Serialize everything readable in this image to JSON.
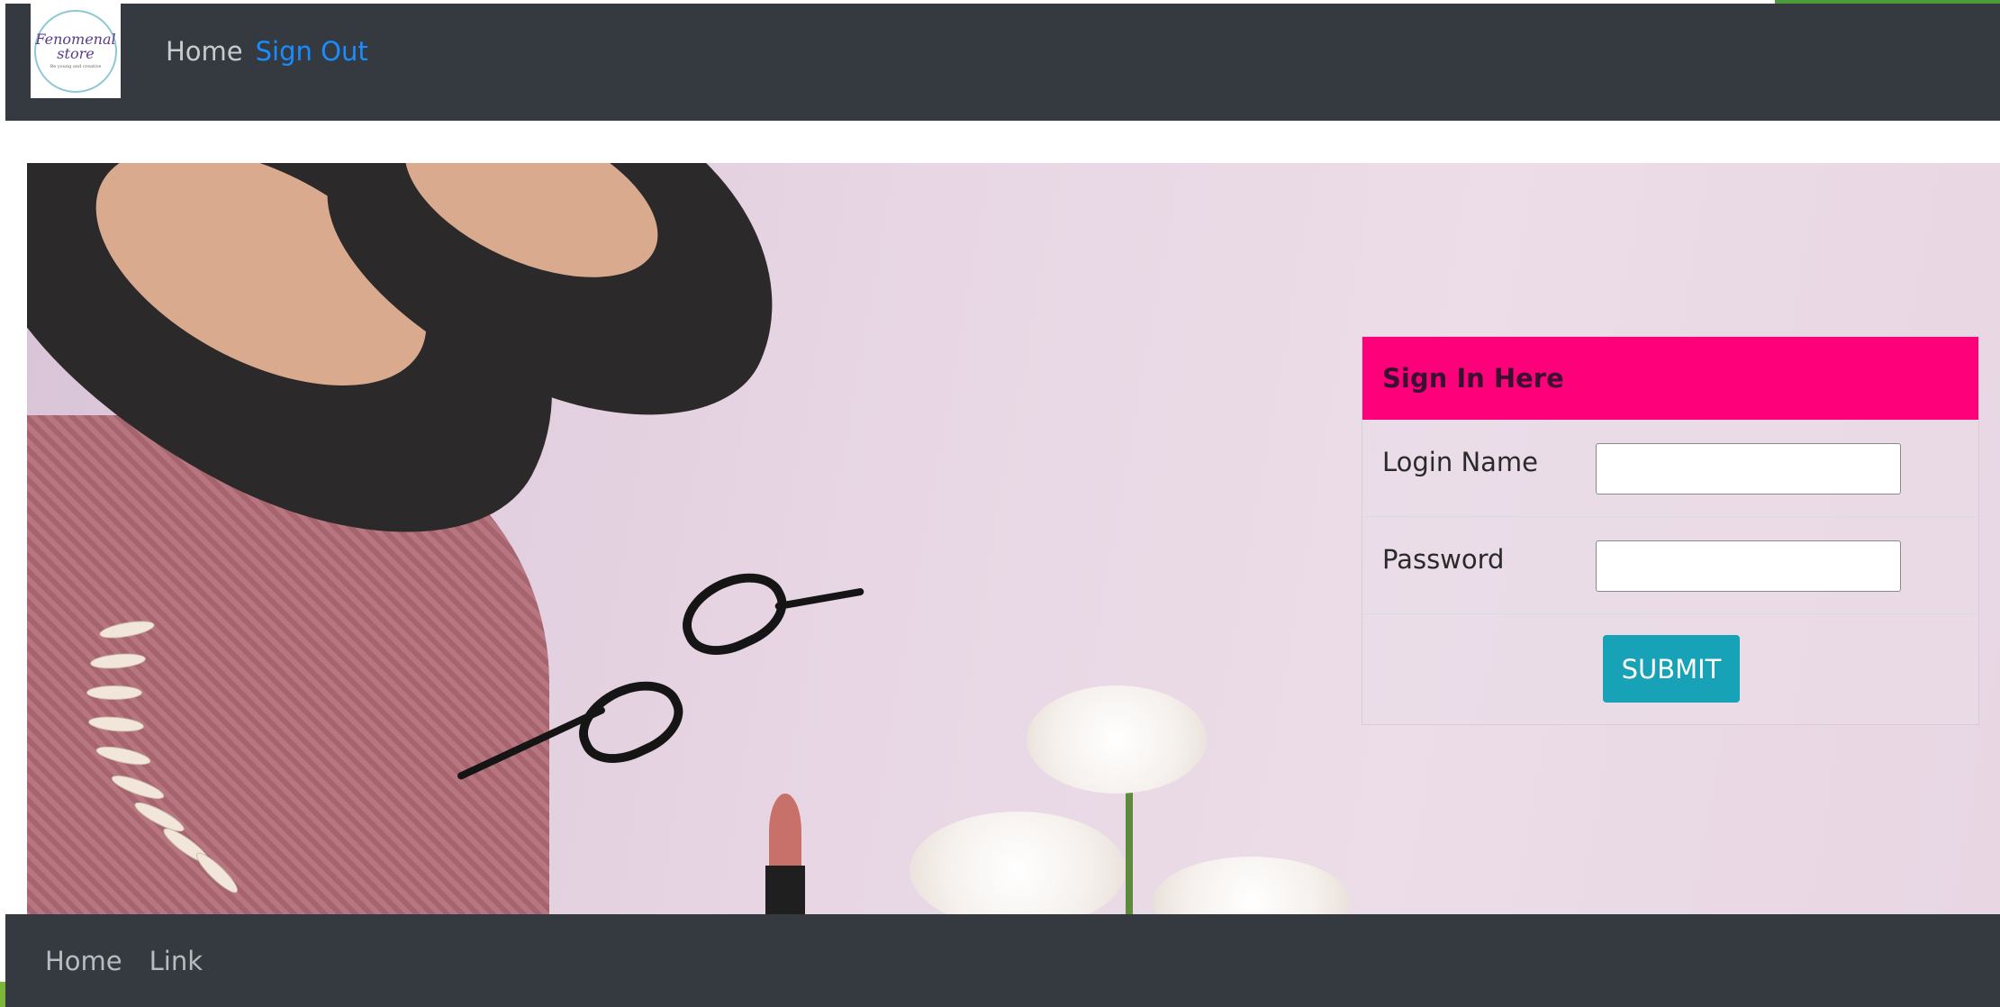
{
  "logo": {
    "name": "Fenomenal",
    "name2": "store",
    "tagline": "Be young and creative"
  },
  "navbar": {
    "home": "Home",
    "sign_out": "Sign Out"
  },
  "signin": {
    "title": "Sign In Here",
    "login_label": "Login Name",
    "login_value": "",
    "password_label": "Password",
    "password_value": "",
    "submit": "SUBMIT"
  },
  "footer": {
    "home": "Home",
    "link": "Link"
  },
  "colors": {
    "navbar_bg": "#343a40",
    "signin_header": "#ff007b",
    "submit_button": "#17a2b8",
    "sign_out_link": "#1a8cff"
  }
}
